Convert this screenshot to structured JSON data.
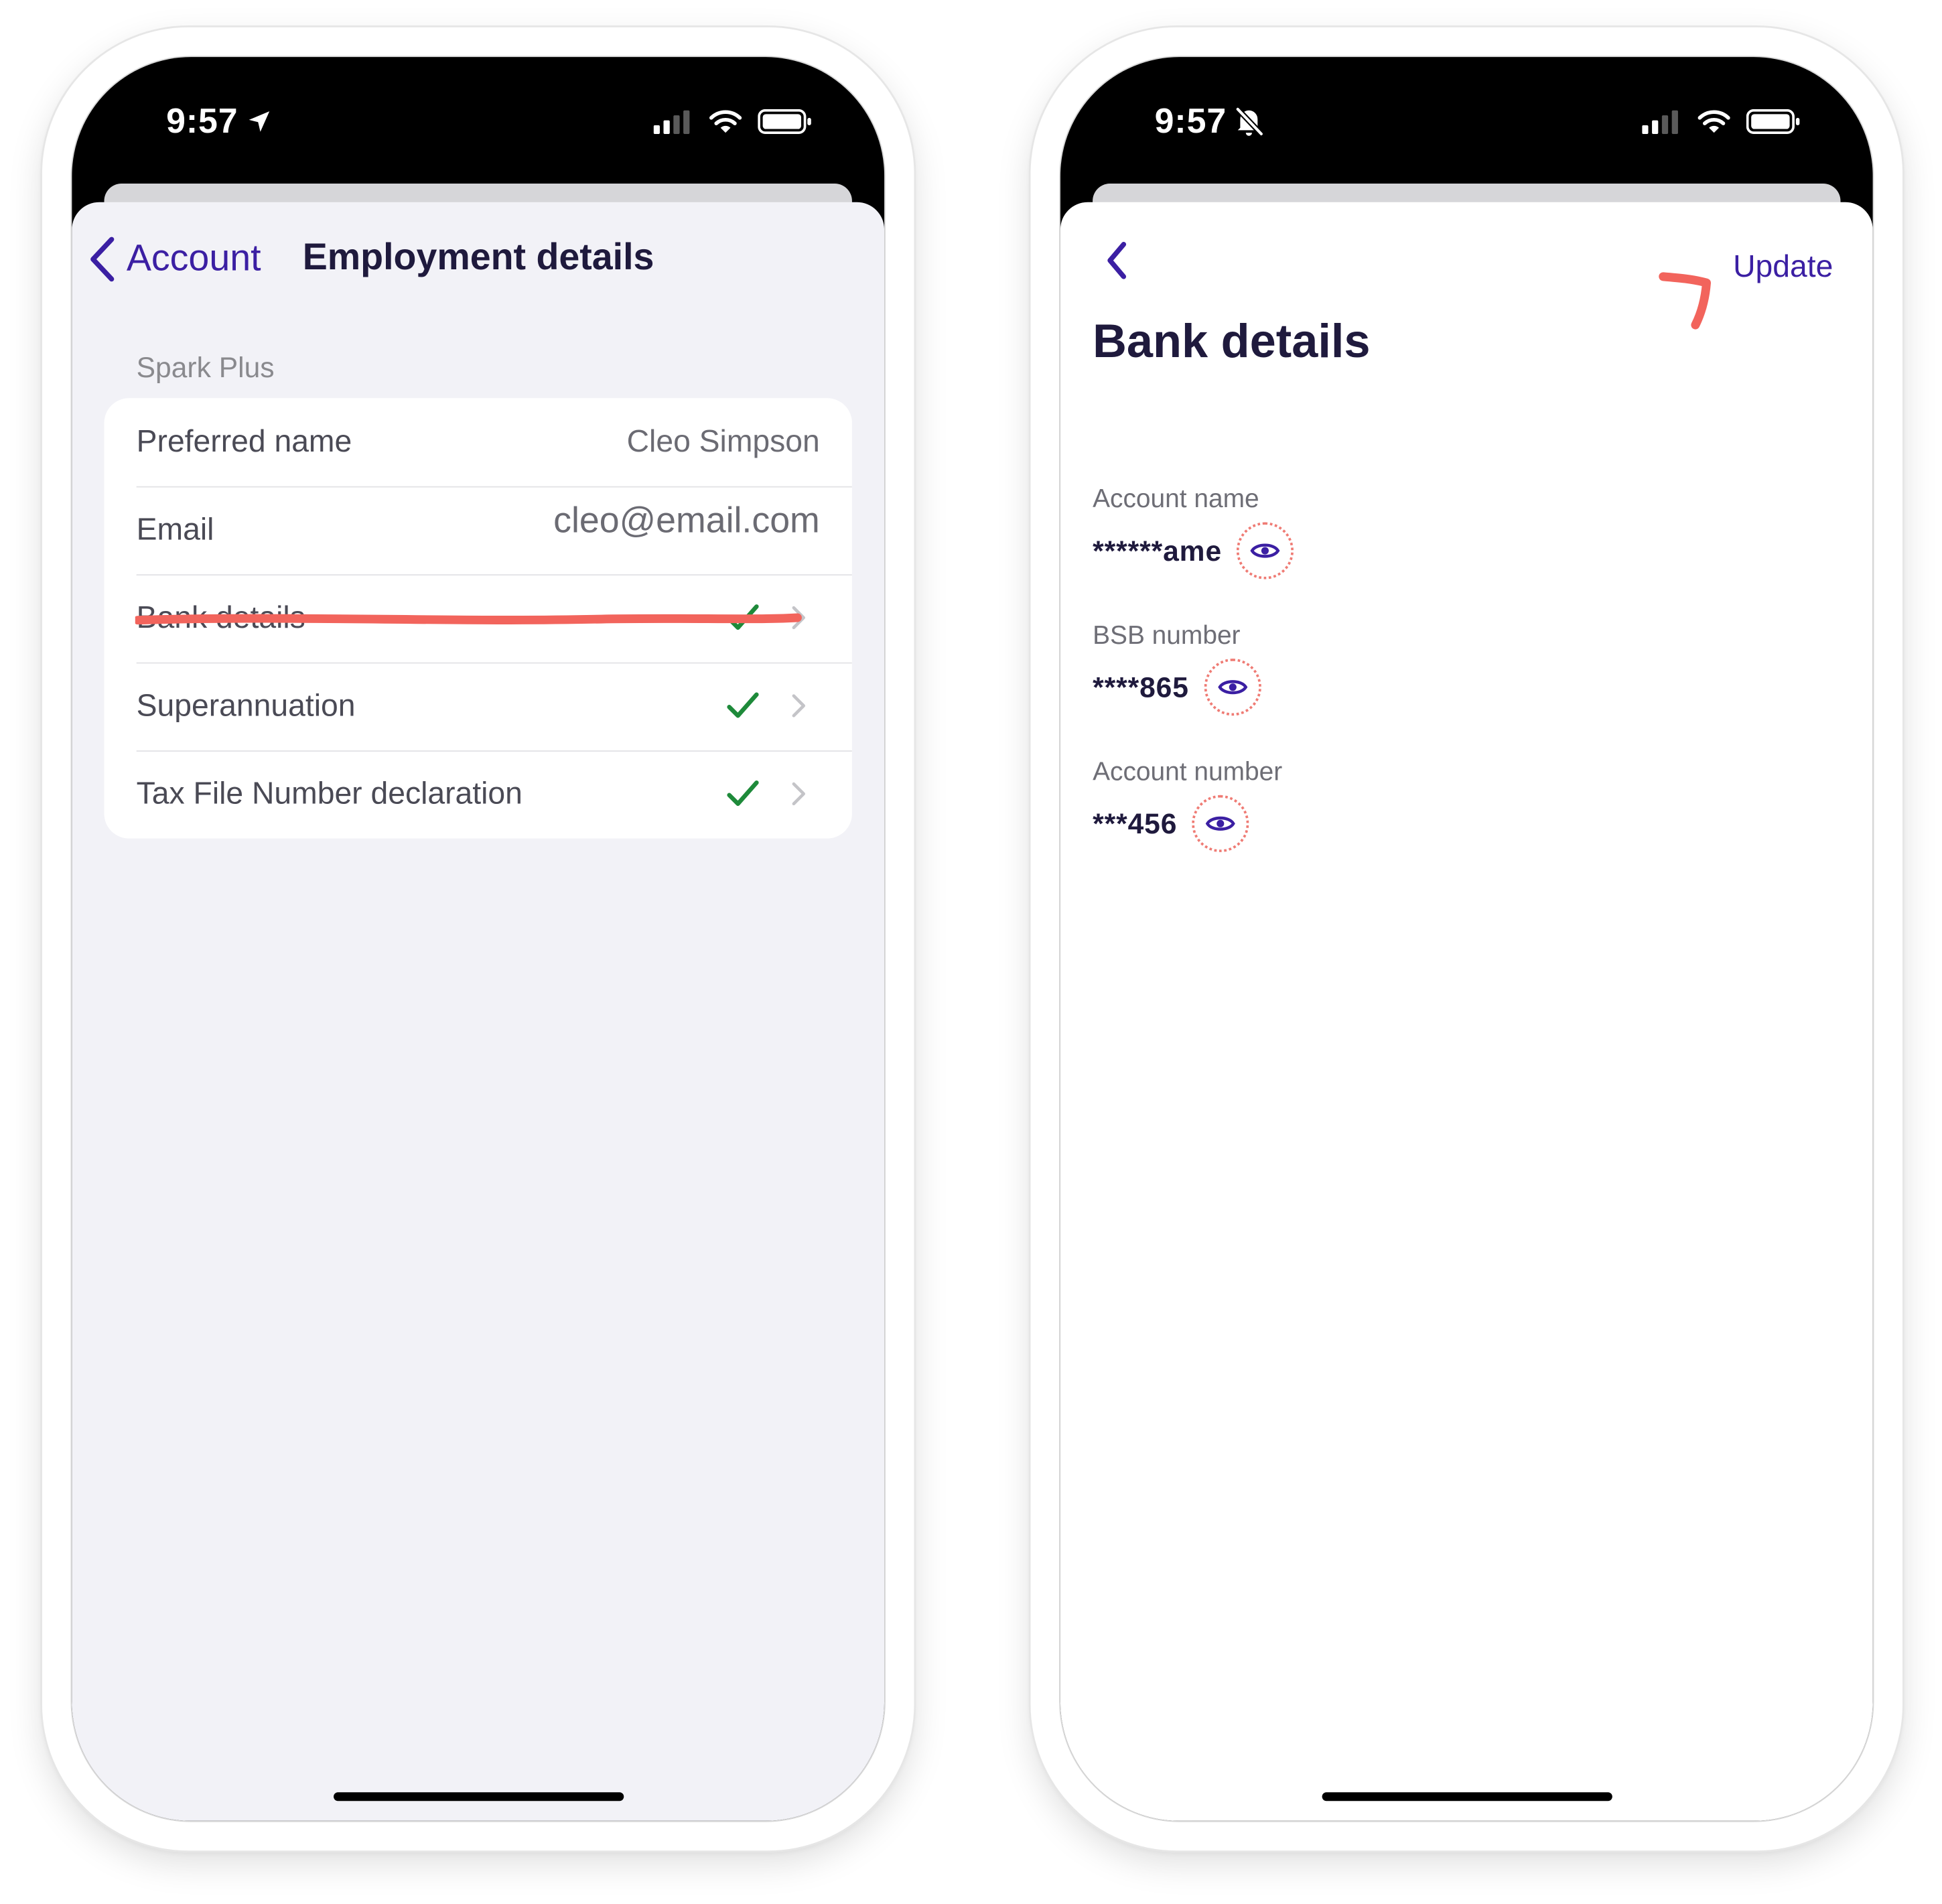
{
  "colors": {
    "accent": "#3b1fa3",
    "title": "#1f1a3d",
    "check": "#1e8a3a",
    "annotation": "#f2645c",
    "grouped_bg": "#f2f2f7"
  },
  "left_phone": {
    "status": {
      "time": "9:57",
      "indicator_icon": "location-arrow-icon"
    },
    "nav": {
      "back_label": "Account",
      "title": "Employment details"
    },
    "section_header": "Spark Plus",
    "rows": [
      {
        "label": "Preferred name",
        "value": "Cleo Simpson"
      },
      {
        "label": "Email",
        "value": "cleo@email.com"
      },
      {
        "label": "Bank details",
        "status_icon": "checkmark-icon",
        "highlighted": true
      },
      {
        "label": "Superannuation",
        "status_icon": "checkmark-icon"
      },
      {
        "label": "Tax File Number declaration",
        "status_icon": "checkmark-icon"
      }
    ]
  },
  "right_phone": {
    "status": {
      "time": "9:57",
      "indicator_icon": "bell-slash-icon"
    },
    "update_label": "Update",
    "title": "Bank details",
    "fields": [
      {
        "label": "Account name",
        "masked_value": "******ame"
      },
      {
        "label": "BSB number",
        "masked_value": "****865"
      },
      {
        "label": "Account number",
        "masked_value": "***456"
      }
    ]
  }
}
